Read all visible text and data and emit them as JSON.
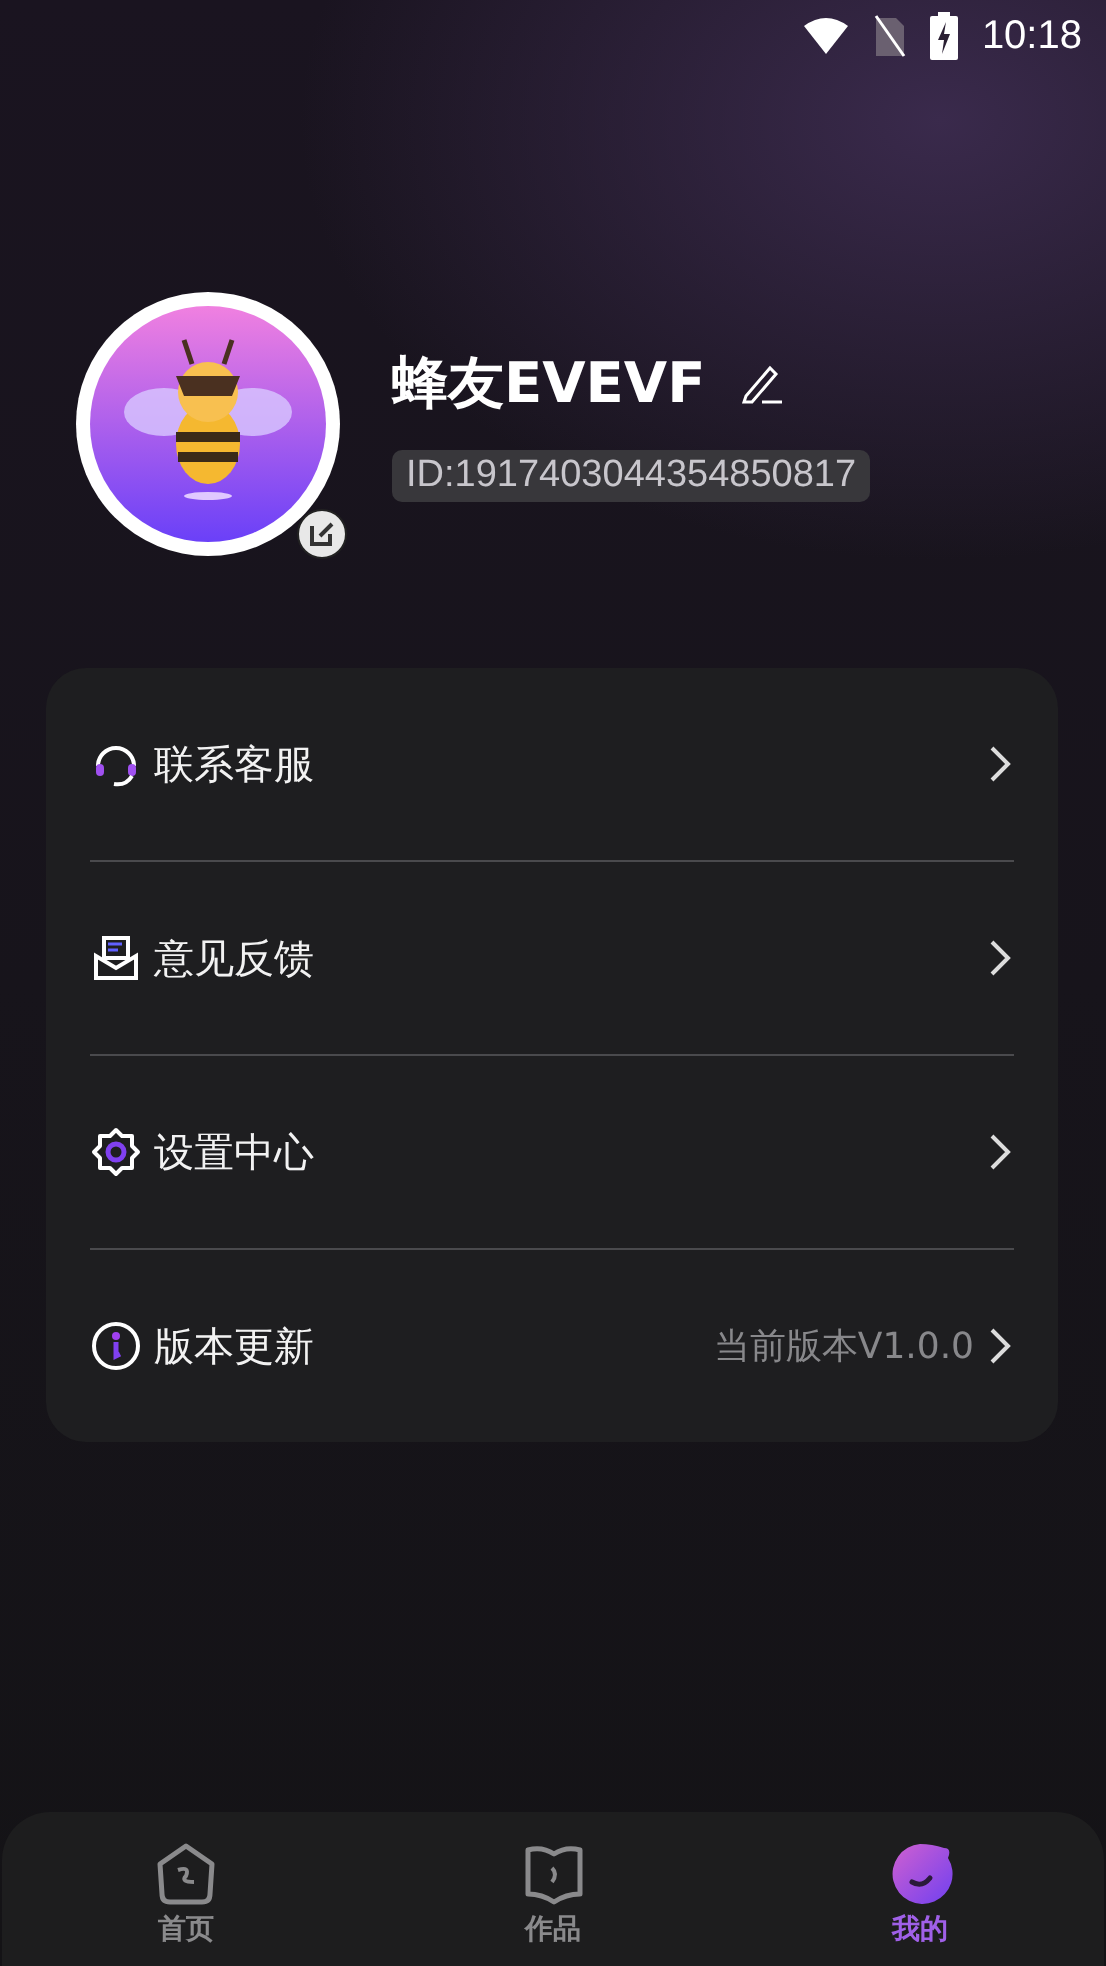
{
  "status_bar": {
    "time": "10:18"
  },
  "profile": {
    "name": "蜂友EVEVF",
    "id": "ID:1917403044354850817"
  },
  "menu": [
    {
      "kind": "support",
      "label": "联系客服"
    },
    {
      "kind": "feedback",
      "label": "意见反馈"
    },
    {
      "kind": "settings",
      "label": "设置中心"
    },
    {
      "kind": "update",
      "label": "版本更新",
      "value": "当前版本V1.0.0"
    }
  ],
  "tabs": [
    {
      "kind": "home",
      "label": "首页",
      "selected": false
    },
    {
      "kind": "works",
      "label": "作品",
      "selected": false
    },
    {
      "kind": "mine",
      "label": "我的",
      "selected": true
    }
  ]
}
